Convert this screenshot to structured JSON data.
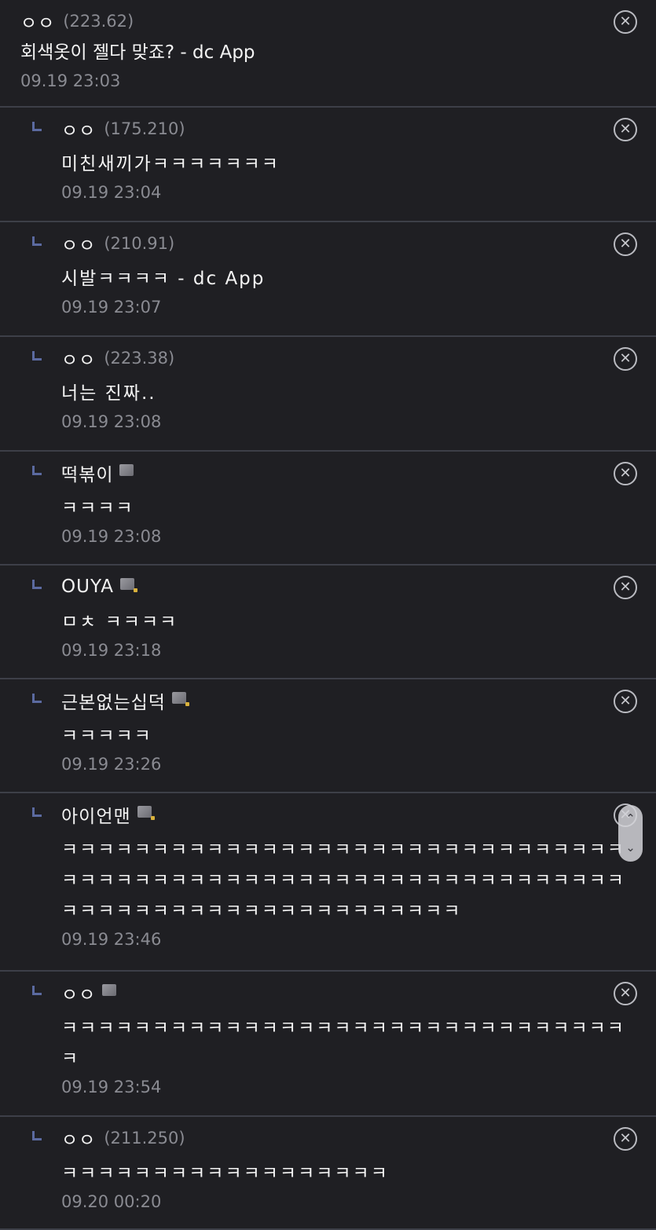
{
  "comments": [
    {
      "author": "ㅇㅇ",
      "ip": "(223.62)",
      "text": "회색옷이 젤다 맞죠? - dc App",
      "date": "09.19 23:03",
      "badge": "",
      "reply": false
    },
    {
      "author": "ㅇㅇ",
      "ip": "(175.210)",
      "text": "미친새끼가ㅋㅋㅋㅋㅋㅋㅋ",
      "date": "09.19 23:04",
      "badge": "",
      "reply": true
    },
    {
      "author": "ㅇㅇ",
      "ip": "(210.91)",
      "text": "시발ㅋㅋㅋㅋ - dc App",
      "date": "09.19 23:07",
      "badge": "",
      "reply": true
    },
    {
      "author": "ㅇㅇ",
      "ip": "(223.38)",
      "text": "너는 진짜..",
      "date": "09.19 23:08",
      "badge": "",
      "reply": true
    },
    {
      "author": "떡볶이",
      "ip": "",
      "text": "ㅋㅋㅋㅋ",
      "date": "09.19 23:08",
      "badge": "fixed",
      "reply": true
    },
    {
      "author": "OUYA",
      "ip": "",
      "text": "ㅁㅊ ㅋㅋㅋㅋ",
      "date": "09.19 23:18",
      "badge": "fixed-gold",
      "reply": true
    },
    {
      "author": "근본없는십덕",
      "ip": "",
      "text": "ㅋㅋㅋㅋㅋ",
      "date": "09.19 23:26",
      "badge": "fixed-gold",
      "reply": true
    },
    {
      "author": "아이언맨",
      "ip": "",
      "text": "ㅋㅋㅋㅋㅋㅋㅋㅋㅋㅋㅋㅋㅋㅋㅋㅋㅋㅋㅋㅋㅋㅋㅋㅋㅋㅋㅋㅋㅋㅋㅋㅋㅋㅋㅋㅋㅋㅋㅋㅋㅋㅋㅋㅋㅋㅋㅋㅋㅋㅋㅋㅋㅋㅋㅋㅋㅋㅋㅋㅋㅋㅋㅋㅋㅋㅋㅋㅋㅋㅋㅋㅋㅋㅋㅋㅋㅋㅋㅋㅋㅋㅋㅋㅋ",
      "date": "09.19 23:46",
      "badge": "fixed-gold",
      "reply": true
    },
    {
      "author": "ㅇㅇ",
      "ip": "",
      "text": "ㅋㅋㅋㅋㅋㅋㅋㅋㅋㅋㅋㅋㅋㅋㅋㅋㅋㅋㅋㅋㅋㅋㅋㅋㅋㅋㅋㅋㅋㅋㅋㅋ",
      "date": "09.19 23:54",
      "badge": "fixed",
      "reply": true
    },
    {
      "author": "ㅇㅇ",
      "ip": "(211.250)",
      "text": "ㅋㅋㅋㅋㅋㅋㅋㅋㅋㅋㅋㅋㅋㅋㅋㅋㅋㅋ",
      "date": "09.20 00:20",
      "badge": "",
      "reply": true
    }
  ],
  "icons": {
    "delete": "close-circle-icon",
    "reply": "reply-corner-icon",
    "badge": "fixed-nick-icon"
  },
  "delete_glyph": "✕",
  "scroll": {
    "up": "⌃",
    "down": "⌄"
  }
}
